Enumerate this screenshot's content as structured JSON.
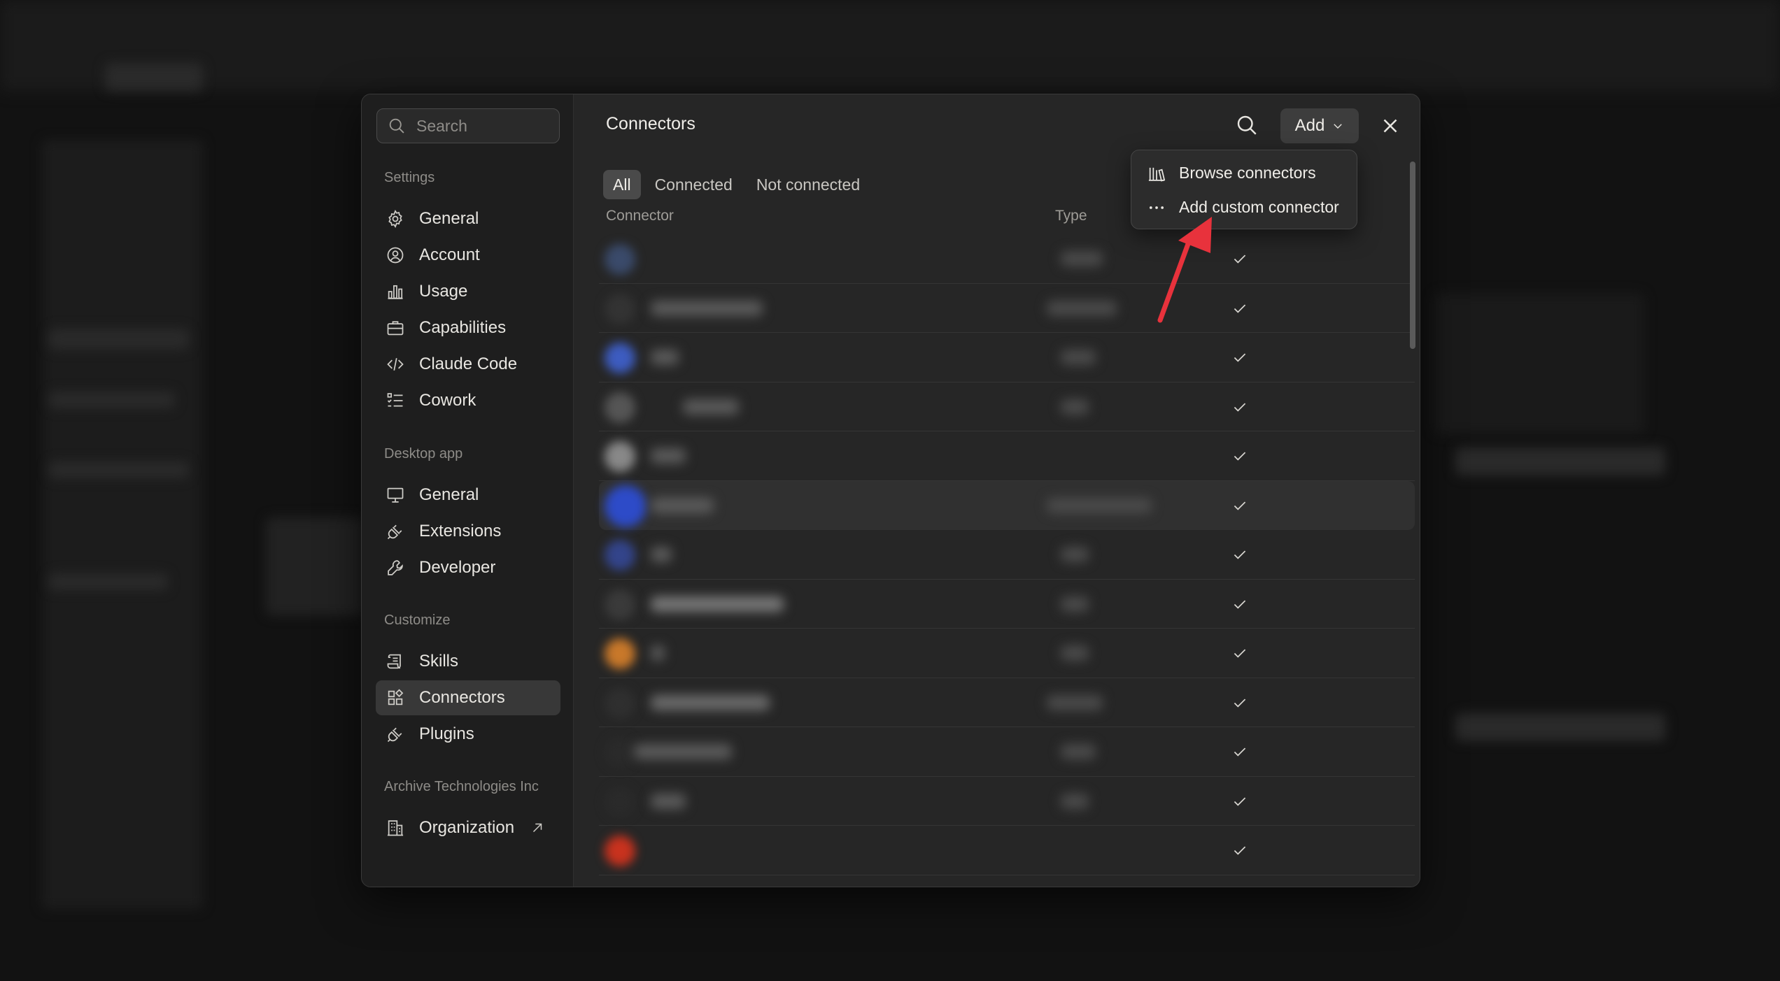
{
  "sidebar": {
    "search_placeholder": "Search",
    "sections": [
      {
        "label": "Settings",
        "items": [
          {
            "label": "General",
            "icon": "gear-icon"
          },
          {
            "label": "Account",
            "icon": "user-circle-icon"
          },
          {
            "label": "Usage",
            "icon": "bar-chart-icon"
          },
          {
            "label": "Capabilities",
            "icon": "briefcase-icon"
          },
          {
            "label": "Claude Code",
            "icon": "code-icon"
          },
          {
            "label": "Cowork",
            "icon": "checklist-icon"
          }
        ]
      },
      {
        "label": "Desktop app",
        "items": [
          {
            "label": "General",
            "icon": "monitor-icon"
          },
          {
            "label": "Extensions",
            "icon": "plug-icon"
          },
          {
            "label": "Developer",
            "icon": "wrench-icon"
          }
        ]
      },
      {
        "label": "Customize",
        "items": [
          {
            "label": "Skills",
            "icon": "scroll-icon"
          },
          {
            "label": "Connectors",
            "icon": "connectors-icon",
            "active": true
          },
          {
            "label": "Plugins",
            "icon": "plug-icon"
          }
        ]
      },
      {
        "label": "Archive Technologies Inc",
        "items": [
          {
            "label": "Organization",
            "icon": "building-icon",
            "external": true
          }
        ]
      }
    ]
  },
  "main": {
    "title": "Connectors",
    "add_label": "Add",
    "tabs": [
      {
        "label": "All",
        "active": true
      },
      {
        "label": "Connected"
      },
      {
        "label": "Not connected"
      }
    ],
    "columns": {
      "connector": "Connector",
      "type": "Type"
    },
    "rows_count_visible": 13,
    "highlighted_row_index": 5
  },
  "dropdown": {
    "items": [
      {
        "label": "Browse connectors",
        "icon": "library-icon"
      },
      {
        "label": "Add custom connector",
        "icon": "ellipsis-icon"
      }
    ]
  },
  "colors": {
    "accent_arrow": "#e8323c",
    "modal_bg": "#262626",
    "sidebar_bg": "#1e1e1e",
    "active_item_bg": "#383838"
  }
}
